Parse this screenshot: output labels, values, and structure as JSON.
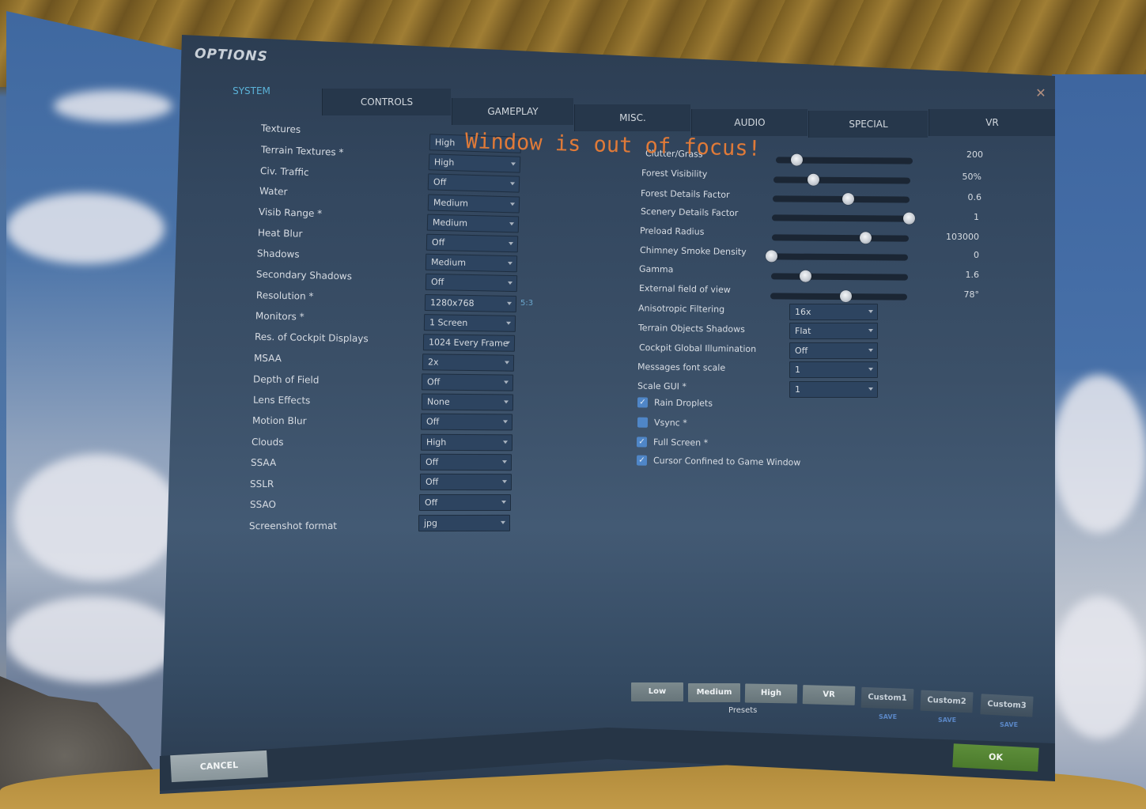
{
  "window": {
    "title": "OPTIONS",
    "close_icon": "close-icon",
    "focus_warning": "Window is out of focus!"
  },
  "tabs": [
    {
      "label": "SYSTEM",
      "active": true
    },
    {
      "label": "CONTROLS",
      "active": false
    },
    {
      "label": "GAMEPLAY",
      "active": false
    },
    {
      "label": "MISC.",
      "active": false
    },
    {
      "label": "AUDIO",
      "active": false
    },
    {
      "label": "SPECIAL",
      "active": false
    },
    {
      "label": "VR",
      "active": false
    }
  ],
  "left_settings": [
    {
      "label": "Textures",
      "value": "High"
    },
    {
      "label": "Terrain Textures *",
      "value": "High"
    },
    {
      "label": "Civ. Traffic",
      "value": "Off"
    },
    {
      "label": "Water",
      "value": "Medium"
    },
    {
      "label": "Visib Range *",
      "value": "Medium"
    },
    {
      "label": "Heat Blur",
      "value": "Off"
    },
    {
      "label": "Shadows",
      "value": "Medium"
    },
    {
      "label": "Secondary Shadows",
      "value": "Off"
    },
    {
      "label": "Resolution *",
      "value": "1280x768",
      "aspect": "5:3"
    },
    {
      "label": "Monitors *",
      "value": "1 Screen"
    },
    {
      "label": "Res. of Cockpit Displays",
      "value": "1024 Every Frame"
    },
    {
      "label": "MSAA",
      "value": "2x"
    },
    {
      "label": "Depth of Field",
      "value": "Off"
    },
    {
      "label": "Lens Effects",
      "value": "None"
    },
    {
      "label": "Motion Blur",
      "value": "Off"
    },
    {
      "label": "Clouds",
      "value": "High"
    },
    {
      "label": "SSAA",
      "value": "Off"
    },
    {
      "label": "SSLR",
      "value": "Off"
    },
    {
      "label": "SSAO",
      "value": "Off"
    },
    {
      "label": "Screenshot format",
      "value": "jpg"
    }
  ],
  "sliders": [
    {
      "label": "Clutter/Grass",
      "value": "200",
      "fraction": 0.15
    },
    {
      "label": "Forest Visibility",
      "value": "50%",
      "fraction": 0.29
    },
    {
      "label": "Forest Details Factor",
      "value": "0.6",
      "fraction": 0.55
    },
    {
      "label": "Scenery Details Factor",
      "value": "1",
      "fraction": 1.0
    },
    {
      "label": "Preload Radius",
      "value": "103000",
      "fraction": 0.68
    },
    {
      "label": "Chimney Smoke Density",
      "value": "0",
      "fraction": 0.0
    },
    {
      "label": "Gamma",
      "value": "1.6",
      "fraction": 0.25
    },
    {
      "label": "External field of view",
      "value": "78°",
      "fraction": 0.55
    }
  ],
  "right_selects": [
    {
      "label": "Anisotropic Filtering",
      "value": "16x"
    },
    {
      "label": "Terrain Objects Shadows",
      "value": "Flat"
    },
    {
      "label": "Cockpit Global Illumination",
      "value": "Off"
    },
    {
      "label": "Messages font scale",
      "value": "1"
    },
    {
      "label": "Scale GUI *",
      "value": "1"
    }
  ],
  "checkboxes": [
    {
      "label": "Rain Droplets",
      "checked": true
    },
    {
      "label": "Vsync *",
      "checked": false
    },
    {
      "label": "Full Screen *",
      "checked": true
    },
    {
      "label": "Cursor Confined to Game Window",
      "checked": true
    }
  ],
  "presets": {
    "label": "Presets",
    "buttons": [
      "Low",
      "Medium",
      "High",
      "VR"
    ],
    "custom": [
      {
        "label": "Custom1",
        "save": "SAVE"
      },
      {
        "label": "Custom2",
        "save": "SAVE"
      },
      {
        "label": "Custom3",
        "save": "SAVE"
      }
    ]
  },
  "footer": {
    "cancel_label": "CANCEL",
    "ok_label": "OK"
  },
  "colors": {
    "active_tab": "#5bb3d9",
    "warning": "#e07a38",
    "ok_button": "#5d8e3a",
    "checkbox": "#4f86c7",
    "save_link": "#5a86c4"
  }
}
